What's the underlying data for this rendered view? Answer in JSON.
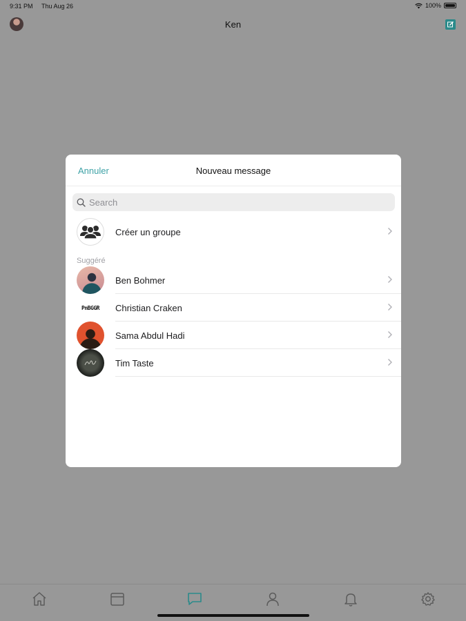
{
  "status_bar": {
    "time": "9:31 PM",
    "date": "Thu Aug 26",
    "battery": "100%"
  },
  "nav": {
    "title": "Ken",
    "profile_icon": "avatar-icon",
    "compose_icon": "compose-icon"
  },
  "modal": {
    "cancel_label": "Annuler",
    "title": "Nouveau message",
    "search_placeholder": "Search",
    "create_group_label": "Créer un groupe",
    "section_label": "Suggéré",
    "contacts": [
      {
        "name": "Ben Bohmer"
      },
      {
        "name": "Christian Craken",
        "avatar_text": "PnBGGR"
      },
      {
        "name": "Sama Abdul Hadi"
      },
      {
        "name": "Tim Taste"
      }
    ]
  },
  "tab_bar": {
    "items": [
      "home-icon",
      "calendar-icon",
      "messages-icon",
      "profile-icon",
      "notifications-icon",
      "settings-icon"
    ],
    "active": "messages-icon"
  },
  "colors": {
    "accent": "#3ea2a6",
    "overlay": "#989898",
    "compose": "#2a8a8a"
  }
}
